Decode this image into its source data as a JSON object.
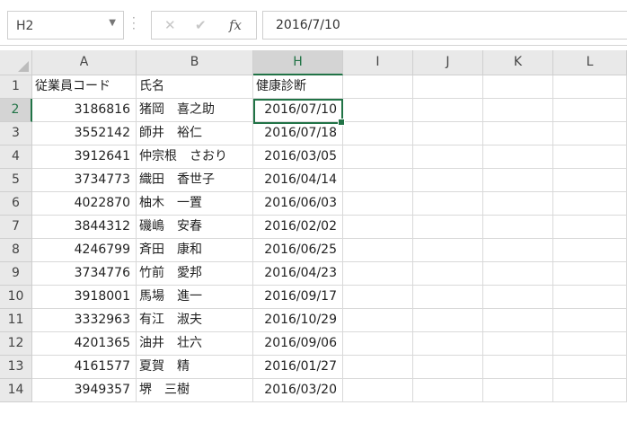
{
  "namebox": {
    "value": "H2"
  },
  "formula": {
    "value": "2016/7/10",
    "fx_label": "fx"
  },
  "columns": [
    "A",
    "B",
    "H",
    "I",
    "J",
    "K",
    "L"
  ],
  "header_row": {
    "row": "1",
    "a": "従業員コード",
    "b": "氏名",
    "h": "健康診断"
  },
  "rows": [
    {
      "row": "2",
      "code": "3186816",
      "name": "猪岡　喜之助",
      "date": "2016/07/10"
    },
    {
      "row": "3",
      "code": "3552142",
      "name": "師井　裕仁",
      "date": "2016/07/18"
    },
    {
      "row": "4",
      "code": "3912641",
      "name": "仲宗根　さおり",
      "date": "2016/03/05"
    },
    {
      "row": "5",
      "code": "3734773",
      "name": "織田　香世子",
      "date": "2016/04/14"
    },
    {
      "row": "6",
      "code": "4022870",
      "name": "柚木　一置",
      "date": "2016/06/03"
    },
    {
      "row": "7",
      "code": "3844312",
      "name": "磯嶋　安春",
      "date": "2016/02/02"
    },
    {
      "row": "8",
      "code": "4246799",
      "name": "斉田　康和",
      "date": "2016/06/25"
    },
    {
      "row": "9",
      "code": "3734776",
      "name": "竹前　愛邦",
      "date": "2016/04/23"
    },
    {
      "row": "10",
      "code": "3918001",
      "name": "馬場　進一",
      "date": "2016/09/17"
    },
    {
      "row": "11",
      "code": "3332963",
      "name": "有江　淑夫",
      "date": "2016/10/29"
    },
    {
      "row": "12",
      "code": "4201365",
      "name": "油井　壮六",
      "date": "2016/09/06"
    },
    {
      "row": "13",
      "code": "4161577",
      "name": "夏賀　精",
      "date": "2016/01/27"
    },
    {
      "row": "14",
      "code": "3949357",
      "name": "堺　三樹",
      "date": "2016/03/20"
    }
  ],
  "colors": {
    "accent": "#217346",
    "header_bg": "#e9e9e9",
    "gridline": "#d9d9d9"
  }
}
